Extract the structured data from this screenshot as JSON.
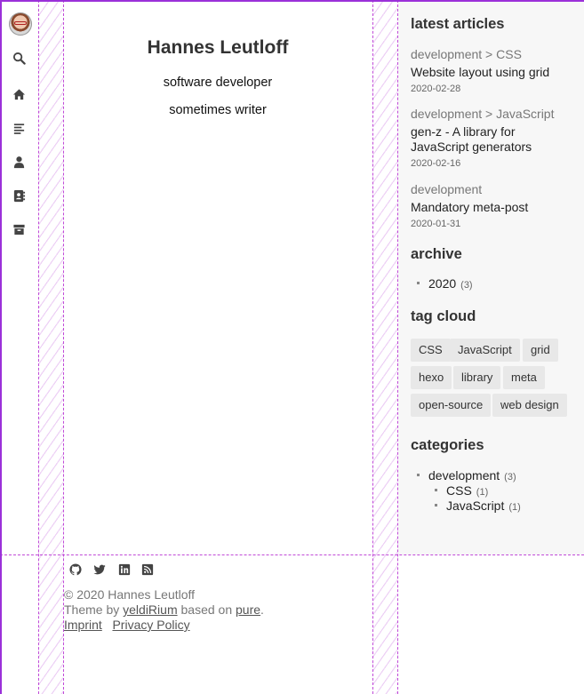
{
  "nav": {
    "avatar_alt": "",
    "items": [
      {
        "icon": "search-icon"
      },
      {
        "icon": "home-icon"
      },
      {
        "icon": "articles-icon"
      },
      {
        "icon": "user-icon"
      },
      {
        "icon": "contact-icon"
      },
      {
        "icon": "archive-icon"
      }
    ]
  },
  "main": {
    "title": "Hannes Leutloff",
    "subtitle_1": "software developer",
    "subtitle_2": "sometimes writer"
  },
  "sidebar": {
    "latest_heading": "latest articles",
    "articles": [
      {
        "category": "development > CSS",
        "title": "Website layout using grid",
        "date": "2020-02-28"
      },
      {
        "category": "development > JavaScript",
        "title_line1": "gen-z - A library for",
        "title_line2": "JavaScript generators",
        "date": "2020-02-16"
      },
      {
        "category": "development",
        "title": "Mandatory meta-post",
        "date": "2020-01-31"
      }
    ],
    "archive_heading": "archive",
    "archive": [
      {
        "label": "2020",
        "count": "(3)"
      }
    ],
    "tag_heading": "tag cloud",
    "tags": [
      "CSS",
      "JavaScript",
      "grid",
      "hexo",
      "library",
      "meta",
      "open-source",
      "web design"
    ],
    "categories_heading": "categories",
    "categories": [
      {
        "label": "development",
        "count": "(3)"
      },
      {
        "label": "CSS",
        "count": "(1)"
      },
      {
        "label": "JavaScript",
        "count": "(1)"
      }
    ]
  },
  "footer": {
    "social": [
      "github-icon",
      "twitter-icon",
      "linkedin-icon",
      "rss-icon"
    ],
    "copyright": "© 2020 Hannes Leutloff",
    "theme_prefix": "Theme by",
    "theme_link": "yeldiRium",
    "based_on": "based on",
    "pure_link": "pure",
    "period": ".",
    "imprint": "Imprint",
    "privacy": "Privacy Policy"
  },
  "colors": {
    "accent_guides": "#c04ad8",
    "sidebar_bg": "#f7f7f7"
  }
}
